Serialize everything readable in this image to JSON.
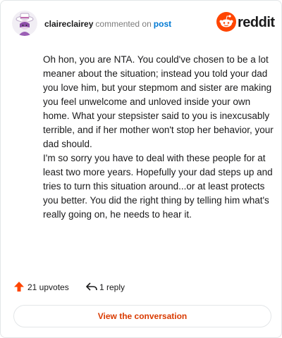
{
  "comment": {
    "username": "claireclairey",
    "verb": "commented on",
    "target": "post",
    "paragraphs": [
      "Oh hon, you are NTA. You could've chosen to be a lot meaner about the situation; instead you told your dad you love him, but your stepmom and sister are making you feel unwelcome and unloved inside your own home. What your stepsister said to you is inexcusably terrible, and if her mother won't stop her behavior, your dad should.",
      "I'm so sorry you have to deal with these people for at least two more years. Hopefully your dad steps up and tries to turn this situation around...or at least protects you better. You did the right thing by telling him what's really going on, he needs to hear it."
    ]
  },
  "brand": {
    "name": "reddit",
    "icon": "reddit-logo-icon",
    "color": "#ff4500"
  },
  "footer": {
    "upvotes_label": "21 upvotes",
    "replies_label": "1 reply",
    "upvote_icon": "upvote-arrow-icon",
    "reply_icon": "reply-arrow-icon",
    "upvote_color": "#ff4500"
  },
  "cta": {
    "label": "View the conversation",
    "color": "#d93a00"
  }
}
